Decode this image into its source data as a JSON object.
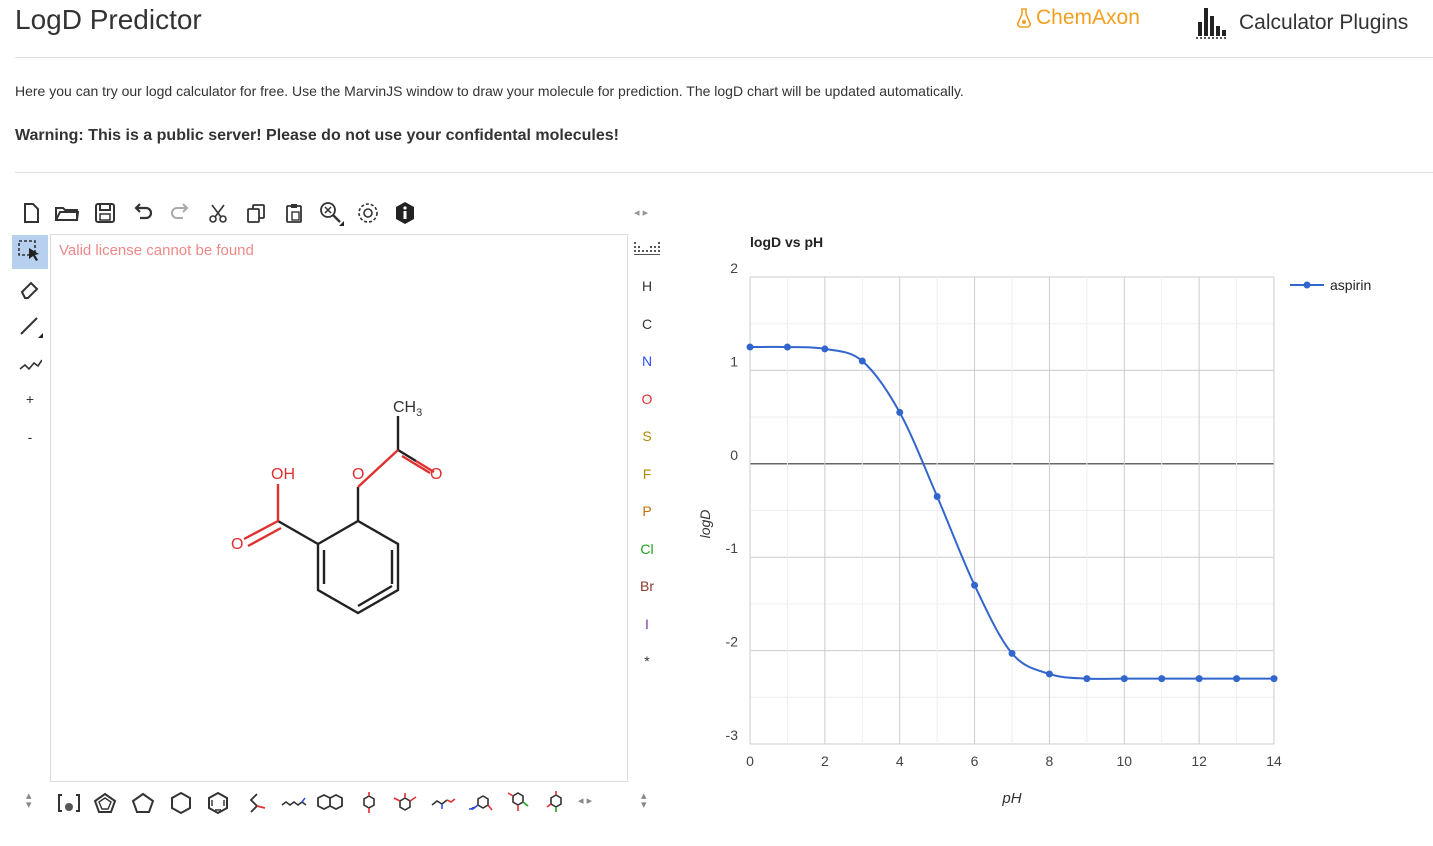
{
  "header": {
    "title": "LogD Predictor",
    "chemaxon_label": "ChemAxon",
    "plugins_label": "Calculator Plugins"
  },
  "intro_text": "Here you can try our logd calculator for free. Use the MarvinJS window to draw your molecule for prediction. The logD chart will be updated automatically.",
  "warning_text": "Warning: This is a public server! Please do not use your confidental molecules!",
  "editor": {
    "license_message": "Valid license cannot be found",
    "top_toolbar": [
      "new-document-icon",
      "open-folder-icon",
      "save-icon",
      "undo-icon",
      "redo-icon",
      "cut-icon",
      "copy-icon",
      "paste-icon",
      "zoom-icon",
      "settings-icon",
      "info-icon"
    ],
    "side_tools": [
      "select-icon",
      "eraser-icon",
      "bond-icon",
      "chain-icon",
      "plus",
      "minus"
    ],
    "side_labels": {
      "plus": "+",
      "minus": "-"
    },
    "elements": [
      {
        "symbol": "H",
        "color": "#333333"
      },
      {
        "symbol": "C",
        "color": "#333333"
      },
      {
        "symbol": "N",
        "color": "#3050f8"
      },
      {
        "symbol": "O",
        "color": "#e03030"
      },
      {
        "symbol": "S",
        "color": "#b08a00"
      },
      {
        "symbol": "F",
        "color": "#b08a00"
      },
      {
        "symbol": "P",
        "color": "#c07000"
      },
      {
        "symbol": "Cl",
        "color": "#20a020"
      },
      {
        "symbol": "Br",
        "color": "#8a3a2a"
      },
      {
        "symbol": "I",
        "color": "#7a3aa0"
      },
      {
        "symbol": "*",
        "color": "#333333"
      }
    ],
    "molecule_labels": {
      "ch3": "CH",
      "ch3_sub": "3",
      "oh": "OH",
      "o_ester": "O",
      "o_carbonyl": "O",
      "o_acid": "O"
    },
    "bottom_templates": [
      "bracket-template-icon",
      "cyclopropane-template-icon",
      "cyclopentane-template-icon",
      "cyclohexane-template-icon",
      "benzene-template-icon",
      "template-1-icon",
      "template-2-icon",
      "naphthalene-template-icon",
      "template-3-icon",
      "template-4-icon",
      "template-5-icon",
      "template-6-icon",
      "template-7-icon",
      "template-8-icon"
    ]
  },
  "chart_data": {
    "type": "line",
    "title": "logD vs pH",
    "xlabel": "pH",
    "ylabel": "logD",
    "xlim": [
      0,
      14
    ],
    "ylim": [
      -3,
      2
    ],
    "xticks": [
      0,
      2,
      4,
      6,
      8,
      10,
      12,
      14
    ],
    "yticks": [
      2,
      1,
      0,
      -1,
      -2,
      -3
    ],
    "grid": true,
    "legend_position": "top-right",
    "series": [
      {
        "name": "aspirin",
        "color": "#3366cc",
        "x": [
          0,
          1,
          2,
          3,
          4,
          5,
          6,
          7,
          8,
          9,
          10,
          11,
          12,
          13,
          14
        ],
        "y": [
          1.25,
          1.25,
          1.23,
          1.1,
          0.55,
          -0.35,
          -1.3,
          -2.03,
          -2.25,
          -2.3,
          -2.3,
          -2.3,
          -2.3,
          -2.3,
          -2.3
        ]
      }
    ]
  }
}
